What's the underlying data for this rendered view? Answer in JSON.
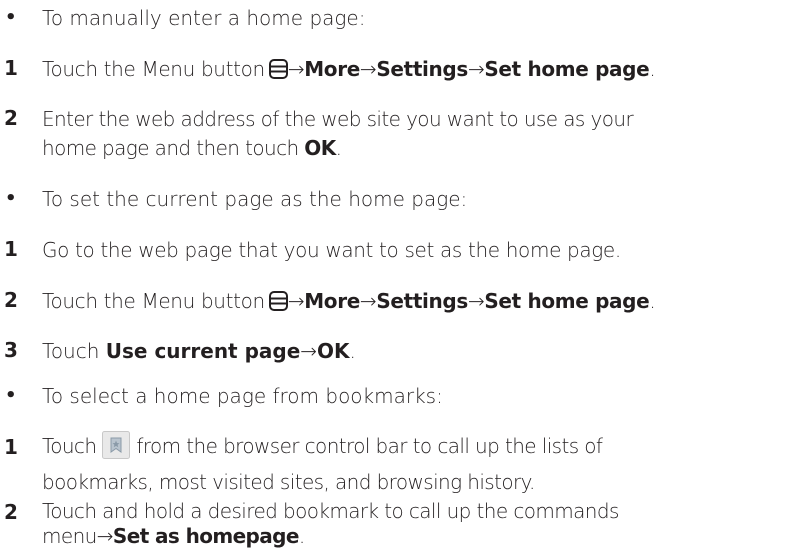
{
  "bullet_glyph": "•",
  "items": [
    {
      "marker": "•",
      "text": "To manually enter a home page:"
    },
    {
      "marker": "1",
      "pre": "Touch the Menu button",
      "arrow1": "→",
      "b1": "More",
      "arrow2": "→",
      "b2": "Settings",
      "arrow3": "→",
      "b3": "Set home page",
      "post": "."
    },
    {
      "marker": "2",
      "pre": "Enter the web address of the web site you want to use as your",
      "line2_pre": "home page and then touch ",
      "bold": "OK",
      "post": "."
    },
    {
      "marker": "•",
      "text": "To set the current page as the home page:"
    },
    {
      "marker": "1",
      "text": "Go to the web page that you want to set as the home page."
    },
    {
      "marker": "2",
      "pre": "Touch the Menu button",
      "arrow1": "→",
      "b1": "More",
      "arrow2": "→",
      "b2": "Settings",
      "arrow3": "→",
      "b3": "Set home page",
      "post": "."
    },
    {
      "marker": "3",
      "pre": "Touch ",
      "b1": "Use current page",
      "arrow1": "→",
      "b2": "OK",
      "post": "."
    },
    {
      "marker": "•",
      "text": "To select a home page from bookmarks:"
    },
    {
      "marker": "1",
      "pre": "Touch",
      "post": "from the browser control bar to call up the lists of",
      "line2": "bookmarks, most visited sites, and browsing history."
    },
    {
      "marker": "2",
      "pre": "Touch and hold a desired bookmark to call up the commands",
      "line2_pre": "menu",
      "arrow1": "→",
      "b1": "Set as homepage",
      "post": "."
    }
  ],
  "icons": {
    "menu": "menu-button-icon",
    "bookmark": "bookmark-icon"
  },
  "colors": {
    "text": "#231f20",
    "icon_border": "#c8c8c8",
    "icon_bg": "#e9e9e9",
    "icon_glyph": "#8a9aa8"
  }
}
